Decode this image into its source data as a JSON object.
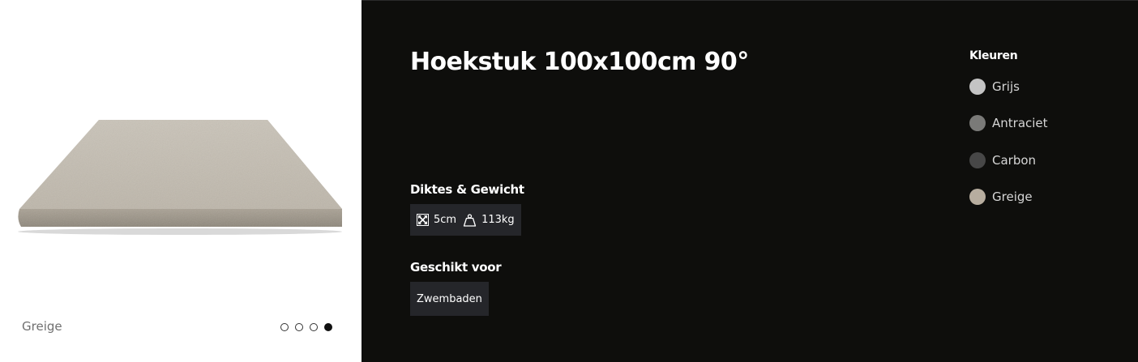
{
  "gallery": {
    "caption": "Greige",
    "dots": [
      {
        "active": false
      },
      {
        "active": false
      },
      {
        "active": false
      },
      {
        "active": true
      }
    ]
  },
  "product": {
    "title": "Hoekstuk 100x100cm 90°"
  },
  "specs": {
    "heading": "Diktes & Gewicht",
    "thickness": {
      "icon": "resize-arrows-icon",
      "value": "5cm"
    },
    "weight": {
      "icon": "weight-icon",
      "value": "113kg"
    }
  },
  "suitable": {
    "heading": "Geschikt voor",
    "tags": [
      "Zwembaden"
    ]
  },
  "colors": {
    "heading": "Kleuren",
    "options": [
      {
        "label": "Grijs",
        "swatch": "#c4c4c4"
      },
      {
        "label": "Antraciet",
        "swatch": "#7a7a78"
      },
      {
        "label": "Carbon",
        "swatch": "#474747"
      },
      {
        "label": "Greige",
        "swatch": "#b7ad9f"
      }
    ]
  }
}
